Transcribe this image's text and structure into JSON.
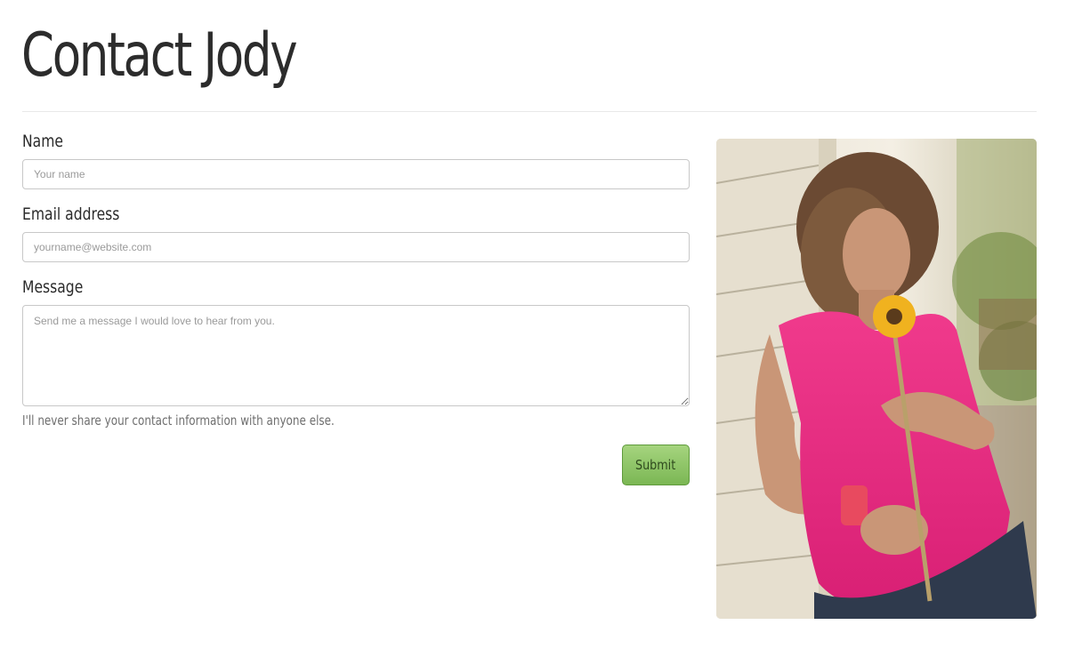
{
  "page": {
    "title": "Contact Jody"
  },
  "form": {
    "name_label": "Name",
    "name_placeholder": "Your name",
    "name_value": "",
    "email_label": "Email address",
    "email_placeholder": "yourname@website.com",
    "email_value": "",
    "message_label": "Message",
    "message_placeholder": "Send me a message I would love to hear from you.",
    "message_value": "",
    "help_text": "I'll never share your contact information with anyone else.",
    "submit_label": "Submit"
  },
  "colors": {
    "submit_button": "#8cc465",
    "shirt": "#e8277e",
    "background": "#ffffff"
  },
  "photo": {
    "alt": "Jody smelling a sunflower"
  }
}
